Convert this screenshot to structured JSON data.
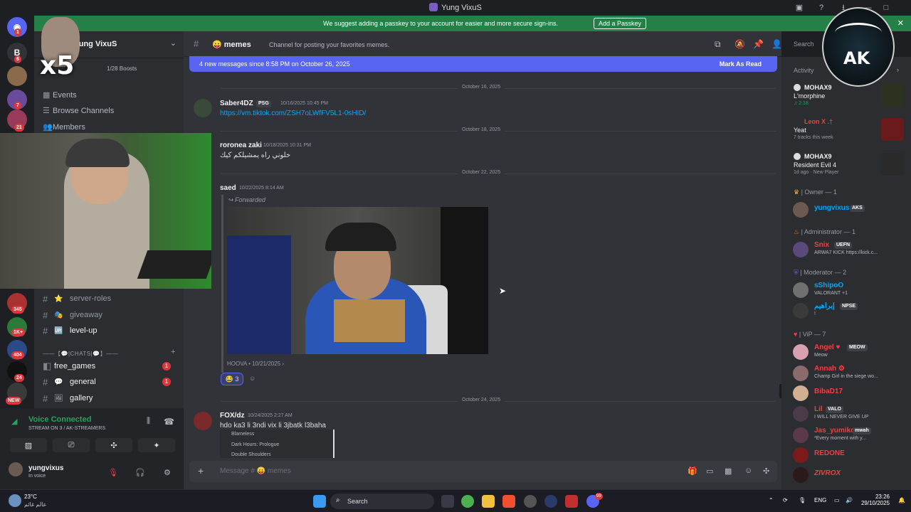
{
  "window": {
    "title": "Yung VixuS",
    "controls": [
      "notifications",
      "help",
      "download",
      "minimize",
      "maximize"
    ]
  },
  "passkey_banner": {
    "text": "We suggest adding a passkey to your account for easier and more secure sign-ins.",
    "button": "Add a Passkey"
  },
  "server_rail": {
    "badges": [
      "1",
      "6",
      "7",
      "21",
      "345",
      "1K+",
      "404",
      "24"
    ],
    "new_label": "NEW",
    "server_letter": "B"
  },
  "server": {
    "name": "Yung VixuS",
    "boosts": "1/28 Boosts",
    "links": [
      "Events",
      "Browse Channels",
      "Members"
    ]
  },
  "overlay": {
    "multiplier": "x5"
  },
  "channels": [
    {
      "emoji": "⭐",
      "name": "server-roles",
      "active": false
    },
    {
      "emoji": "🎭",
      "name": "giveaway",
      "active": false
    },
    {
      "emoji": "🆙",
      "name": "level-up",
      "active": true
    },
    {
      "emoji": "",
      "name": "free_games",
      "active": true,
      "badge": "1"
    },
    {
      "emoji": "💬",
      "name": "general",
      "active": true,
      "badge": "1"
    },
    {
      "emoji": "🖼",
      "name": "gallery",
      "active": true
    }
  ],
  "category": "——【💬|CHATS|💬】——",
  "voice": {
    "status": "Voice Connected",
    "detail": "STREAM ON 3 / AK-STREAMERS",
    "user": "yungvixus",
    "user_status": "In voice"
  },
  "channel_header": {
    "name": "memes",
    "emoji": "😛",
    "topic": "Channel for posting your favorites memes.",
    "search_placeholder": "Search"
  },
  "new_messages": {
    "text": "4 new messages since 8:58 PM on October 26, 2025",
    "action": "Mark As Read"
  },
  "messages": [
    {
      "date": "October 16, 2025",
      "author": "Saber4DZ",
      "tag": "PSG",
      "time": "10/16/2025 10:45 PM",
      "text": "https://vm.tiktok.com/ZSH7oLWfFV5L1-0sHID/"
    },
    {
      "date": "October 18, 2025",
      "author": "roronea zaki",
      "time": "10/18/2025 10:31 PM",
      "text": "خلوني راه يمشيلكم كيك"
    },
    {
      "date": "October 22, 2025",
      "author": "saed",
      "time": "10/22/2025 8:14 AM",
      "forwarded": "Forwarded",
      "source": "HOOVA • 10/21/2025 ›",
      "reaction": "😂 3"
    },
    {
      "date": "October 24, 2025",
      "author": "FOX/dz",
      "time": "10/24/2025 2:27 AM",
      "text": "hdo ka3 li 3ndi vix li 3jbatk l3baha",
      "embed": [
        "Blameless",
        "Dark Hours: Prologue",
        "Double Shoulders"
      ]
    }
  ],
  "composer": {
    "placeholder": "Message # 😛 memes"
  },
  "activity": {
    "title": "Activity",
    "items": [
      {
        "user": "MOHAX9",
        "title": "L'morphine",
        "meta": "♫ 2:18"
      },
      {
        "user": "Leon X .†",
        "title": "Yeat",
        "meta": "7 tracks this week"
      },
      {
        "user": "MOHAX9",
        "title": "Resident Evil 4",
        "meta": "1d ago · New Player"
      }
    ]
  },
  "members": {
    "groups": [
      {
        "label": "Owner — 1",
        "members": [
          {
            "name": "yungvixus",
            "tag": "AKS",
            "color": "#00a8fc",
            "status": ""
          }
        ]
      },
      {
        "label": "Administrator — 1",
        "members": [
          {
            "name": "Snix",
            "tag": "UEFN",
            "color": "#f23f43",
            "status": "ARWA7 KICK https://kick.c..."
          }
        ]
      },
      {
        "label": "Moderator — 2",
        "members": [
          {
            "name": "sShipoO",
            "tag": "",
            "color": "#00a8fc",
            "status": "VALORANT +1"
          },
          {
            "name": "إبراهيم",
            "tag": "NPSE",
            "color": "#00a8fc",
            "status": "!"
          }
        ]
      },
      {
        "label": "ViP — 7",
        "members": [
          {
            "name": "Angel ♥",
            "tag": "MEOW",
            "color": "#f23f43",
            "status": "Meow"
          },
          {
            "name": "Annah ⚙",
            "tag": "",
            "color": "#f23f43",
            "status": "Champ Girl in the siege wo..."
          },
          {
            "name": "BibaD17",
            "tag": "",
            "color": "#f23f43",
            "status": ""
          },
          {
            "name": "Lil",
            "tag": "VALO",
            "color": "#f23f43",
            "status": "I WILL NEVER GIVE UP"
          },
          {
            "name": "Jas_yumiko",
            "tag": "mwah",
            "color": "#f23f43",
            "status": "*Every moment with y..."
          },
          {
            "name": "REDONE",
            "tag": "",
            "color": "#f23f43",
            "status": ""
          },
          {
            "name": "ZIVROX",
            "tag": "",
            "color": "#f23f43",
            "status": ""
          }
        ]
      }
    ]
  },
  "taskbar": {
    "weather_temp": "23°C",
    "weather_text": "عالم غائم",
    "search": "Search",
    "lang": "ENG",
    "time": "23:26",
    "date": "29/10/2025",
    "discord_badge": "99"
  },
  "badge": {
    "text": "AK"
  }
}
